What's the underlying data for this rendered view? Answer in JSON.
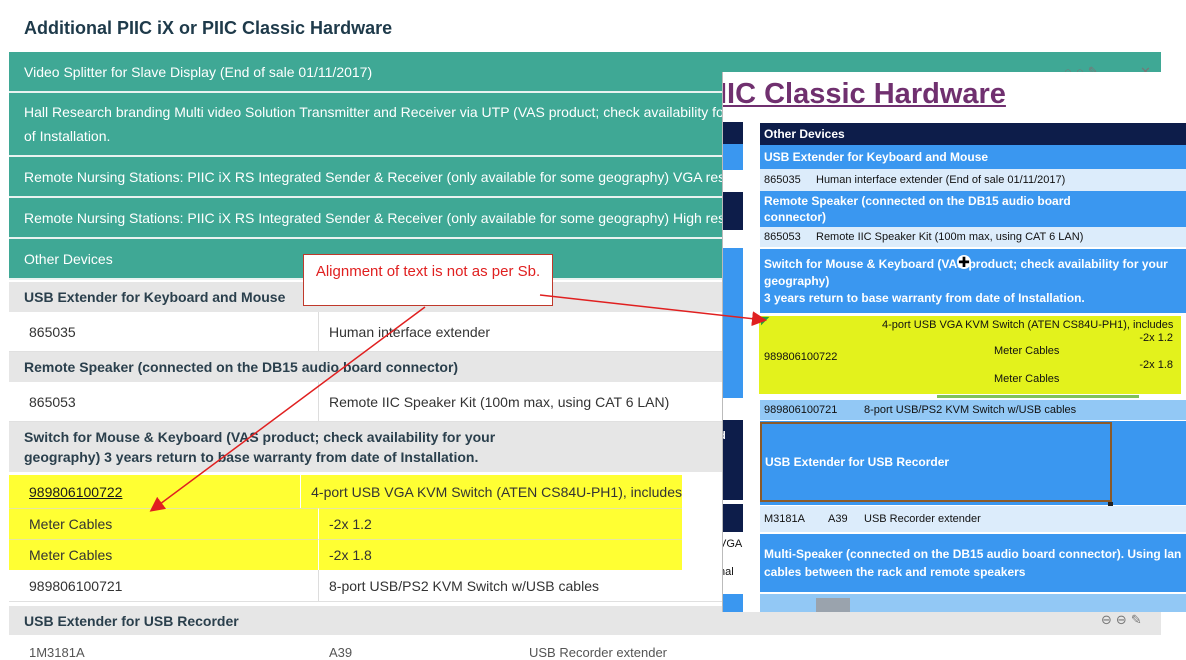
{
  "page_title": "Additional PIIC iX or PIIC Classic Hardware",
  "teal_rows": [
    "Video Splitter for Slave Display (End of sale 01/11/2017)",
    "Hall Research branding Multi video Solution Transmitter and Receiver via UTP (VAS product; check availability for",
    "of Installation.",
    "Remote Nursing Stations: PIIC iX RS Integrated Sender & Receiver (only available for some geography) VGA resol",
    "Remote Nursing Stations: PIIC iX RS Integrated Sender & Receiver (only available for some geography) High resol",
    "Other Devices"
  ],
  "sections": {
    "usb_kbd": "USB Extender for Keyboard and Mouse",
    "speaker": "Remote Speaker (connected on the DB15 audio board connector)",
    "switch_line1": "Switch for Mouse & Keyboard (VAS product; check availability for your",
    "switch_line2": "geography) 3 years return to base warranty from date of Installation.",
    "usb_recorder": "USB Extender for USB Recorder"
  },
  "rows": {
    "r1": {
      "code": "865035",
      "desc": "Human interface extender"
    },
    "r2": {
      "code": "865053",
      "desc": "Remote IIC Speaker Kit (100m max, using CAT 6 LAN)"
    },
    "r3": {
      "code": "989806100722",
      "desc": "4-port USB VGA KVM Switch (ATEN CS84U-PH1), includes"
    },
    "r4": {
      "code": "Meter Cables",
      "desc": "-2x 1.2"
    },
    "r5": {
      "code": "Meter Cables",
      "desc": "-2x 1.8"
    },
    "r6": {
      "code": "989806100721",
      "desc": "8-port USB/PS2 KVM Switch w/USB cables"
    }
  },
  "bottom_partial": [
    "1M3181A",
    "A39",
    "USB Recorder extender"
  ],
  "callout": "Alignment of text is not as per Sb.",
  "overlay": {
    "title": "IIC Classic Hardware",
    "other_devices": "Other Devices",
    "usb_kbd": "USB Extender for Keyboard and Mouse",
    "r1_code": "865035",
    "r1_desc": "Human interface extender (End of sale 01/11/2017)",
    "speaker_l1": "Remote Speaker (connected on the DB15 audio board",
    "speaker_l2": "connector)",
    "r2_code": "865053",
    "r2_desc": "Remote IIC Speaker Kit (100m max, using CAT 6 LAN)",
    "switch_l1": "Switch  for Mouse & Keyboard (VAS product; check availability for your",
    "switch_l2": "geography)",
    "switch_l3": "3 years return to base warranty from date of Installation.",
    "kvm_desc": "4-port USB VGA KVM Switch (ATEN CS84U-PH1), includes",
    "kvm_a": "-2x 1.2",
    "kvm_meter1": "Meter Cables",
    "kvm_code": "989806100722",
    "kvm_b": "-2x 1.8",
    "kvm_meter2": "Meter Cables",
    "r6_code": "989806100721",
    "r6_desc": "8-port USB/PS2 KVM Switch w/USB cables",
    "recorder": "USB Extender for USB Recorder",
    "rec_code": "M3181A",
    "rec_opt": "A39",
    "rec_desc": "USB Recorder  extender",
    "multi_l1": "Multi-Speaker (connected on the DB15 audio board connector). Using lan",
    "multi_l2": "cables between the rack and remote speakers",
    "left_frag_d": "d",
    "left_frag_vga": "VGA",
    "left_frag_paren": ")",
    "left_frag_nal": "nal"
  }
}
